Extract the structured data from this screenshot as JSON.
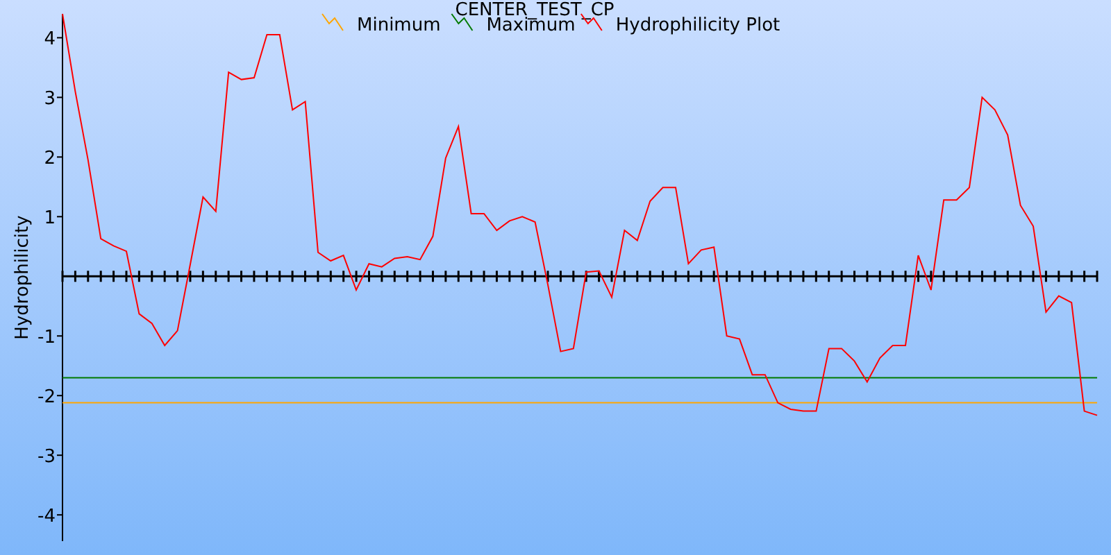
{
  "chart": {
    "chart_data": {
      "type": "line",
      "title": "CENTER_TEST_CP",
      "legend": true,
      "ylabel": "Hydrophilicity",
      "ylim": [
        -4.44,
        4.4
      ],
      "yticks": [
        -4,
        -3,
        -2,
        -1,
        1,
        2,
        3,
        4
      ],
      "series": [
        {
          "name": "Minimum",
          "color": "#ffa500",
          "values": [
            -2.12,
            -2.12,
            -2.12,
            -2.12,
            -2.12,
            -2.12,
            -2.12,
            -2.12,
            -2.12,
            -2.12,
            -2.12,
            -2.12,
            -2.12,
            -2.12,
            -2.12,
            -2.12,
            -2.12,
            -2.12,
            -2.12,
            -2.12,
            -2.12,
            -2.12,
            -2.12,
            -2.12,
            -2.12,
            -2.12,
            -2.12,
            -2.12,
            -2.12,
            -2.12,
            -2.12,
            -2.12,
            -2.12,
            -2.12,
            -2.12,
            -2.12,
            -2.12,
            -2.12,
            -2.12,
            -2.12,
            -2.12,
            -2.12,
            -2.12,
            -2.12,
            -2.12,
            -2.12,
            -2.12,
            -2.12,
            -2.12,
            -2.12,
            -2.12,
            -2.12,
            -2.12,
            -2.12,
            -2.12,
            -2.12,
            -2.12,
            -2.12,
            -2.12,
            -2.12,
            -2.12,
            -2.12,
            -2.12,
            -2.12,
            -2.12,
            -2.12,
            -2.12,
            -2.12,
            -2.12,
            -2.12,
            -2.12,
            -2.12,
            -2.12,
            -2.12,
            -2.12,
            -2.12,
            -2.12,
            -2.12,
            -2.12,
            -2.12,
            -2.12,
            -2.12
          ]
        },
        {
          "name": "Maximum",
          "color": "#007a00",
          "values": [
            -1.7,
            -1.7,
            -1.7,
            -1.7,
            -1.7,
            -1.7,
            -1.7,
            -1.7,
            -1.7,
            -1.7,
            -1.7,
            -1.7,
            -1.7,
            -1.7,
            -1.7,
            -1.7,
            -1.7,
            -1.7,
            -1.7,
            -1.7,
            -1.7,
            -1.7,
            -1.7,
            -1.7,
            -1.7,
            -1.7,
            -1.7,
            -1.7,
            -1.7,
            -1.7,
            -1.7,
            -1.7,
            -1.7,
            -1.7,
            -1.7,
            -1.7,
            -1.7,
            -1.7,
            -1.7,
            -1.7,
            -1.7,
            -1.7,
            -1.7,
            -1.7,
            -1.7,
            -1.7,
            -1.7,
            -1.7,
            -1.7,
            -1.7,
            -1.7,
            -1.7,
            -1.7,
            -1.7,
            -1.7,
            -1.7,
            -1.7,
            -1.7,
            -1.7,
            -1.7,
            -1.7,
            -1.7,
            -1.7,
            -1.7,
            -1.7,
            -1.7,
            -1.7,
            -1.7,
            -1.7,
            -1.7,
            -1.7,
            -1.7,
            -1.7,
            -1.7,
            -1.7,
            -1.7,
            -1.7,
            -1.7,
            -1.7,
            -1.7,
            -1.7,
            -1.7
          ]
        },
        {
          "name": "Hydrophilicity Plot",
          "color": "#ff0000",
          "values": [
            4.4,
            3.1,
            1.95,
            0.63,
            0.51,
            0.42,
            -0.63,
            -0.79,
            -1.16,
            -0.91,
            0.2,
            1.33,
            1.09,
            3.42,
            3.3,
            3.33,
            4.05,
            4.05,
            2.79,
            2.93,
            0.4,
            0.26,
            0.35,
            -0.23,
            0.21,
            0.16,
            0.3,
            0.33,
            0.28,
            0.67,
            1.98,
            2.51,
            1.05,
            1.05,
            0.77,
            0.93,
            1.0,
            0.91,
            -0.14,
            -1.26,
            -1.21,
            0.07,
            0.09,
            -0.35,
            0.77,
            0.6,
            1.26,
            1.49,
            1.49,
            0.21,
            0.44,
            0.49,
            -1.0,
            -1.05,
            -1.65,
            -1.65,
            -2.12,
            -2.23,
            -2.26,
            -2.26,
            -1.21,
            -1.21,
            -1.42,
            -1.77,
            -1.37,
            -1.16,
            -1.16,
            0.35,
            -0.23,
            1.28,
            1.28,
            1.49,
            3.0,
            2.79,
            2.37,
            1.19,
            0.84,
            -0.6,
            -0.33,
            -0.44,
            -2.26,
            -2.33
          ]
        }
      ]
    }
  }
}
